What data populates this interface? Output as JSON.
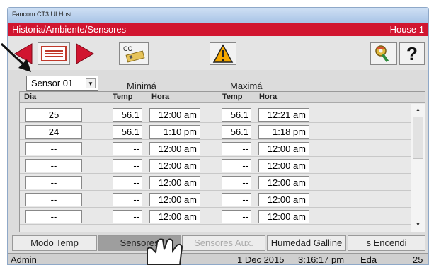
{
  "window": {
    "title": "Fancom.CT3.UI.Host"
  },
  "header": {
    "title": "Historia/Ambiente/Sensores",
    "house": "House 1"
  },
  "toolbar": {
    "cc_label": "CC",
    "help_label": "?"
  },
  "sensor": {
    "selected": "Sensor 01"
  },
  "labels": {
    "min": "Minimá",
    "max": "Maximá"
  },
  "table": {
    "headers": {
      "dia": "Dia",
      "temp1": "Temp",
      "hora1": "Hora",
      "temp2": "Temp",
      "hora2": "Hora"
    },
    "rows": [
      {
        "dia": "25",
        "t1": "56.1",
        "h1": "12:00 am",
        "t2": "56.1",
        "h2": "12:21 am"
      },
      {
        "dia": "24",
        "t1": "56.1",
        "h1": "1:10 pm",
        "t2": "56.1",
        "h2": "1:18 pm"
      },
      {
        "dia": "--",
        "t1": "--",
        "h1": "12:00 am",
        "t2": "--",
        "h2": "12:00 am"
      },
      {
        "dia": "--",
        "t1": "--",
        "h1": "12:00 am",
        "t2": "--",
        "h2": "12:00 am"
      },
      {
        "dia": "--",
        "t1": "--",
        "h1": "12:00 am",
        "t2": "--",
        "h2": "12:00 am"
      },
      {
        "dia": "--",
        "t1": "--",
        "h1": "12:00 am",
        "t2": "--",
        "h2": "12:00 am"
      },
      {
        "dia": "--",
        "t1": "--",
        "h1": "12:00 am",
        "t2": "--",
        "h2": "12:00 am"
      }
    ]
  },
  "tabs": [
    {
      "label": "Modo Temp"
    },
    {
      "label": "Sensores"
    },
    {
      "label": "Sensores Aux."
    },
    {
      "label": "Humedad Galline"
    },
    {
      "label": "s Encendi"
    }
  ],
  "status": {
    "user": "Admin",
    "date": "1 Dec 2015",
    "time": "3:16:17 pm",
    "eda_label": "Eda",
    "eda_value": "25"
  },
  "colors": {
    "title_bar": "#d11530",
    "arrow": "#d11530",
    "warning": "#f5a800"
  }
}
